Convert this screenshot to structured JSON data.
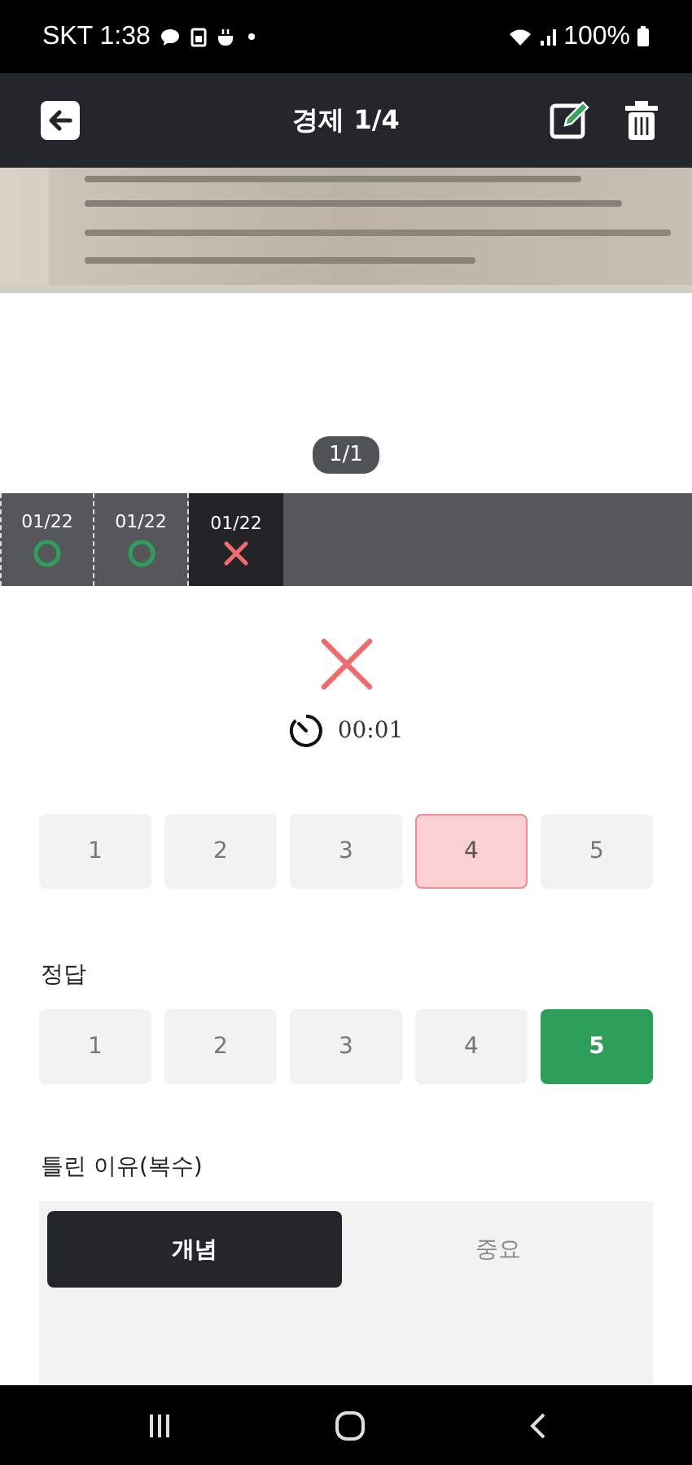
{
  "status_bar": {
    "carrier_time": "SKT 1:38",
    "battery": "100%"
  },
  "app_bar": {
    "title": "경제 1/4"
  },
  "page_indicator": "1/1",
  "history": [
    {
      "date": "01/22",
      "kind": "correct",
      "selected": false
    },
    {
      "date": "01/22",
      "kind": "correct",
      "selected": false
    },
    {
      "date": "01/22",
      "kind": "wrong",
      "selected": true
    }
  ],
  "result": {
    "kind": "wrong",
    "time": "00:01"
  },
  "my_answer": {
    "options": [
      {
        "label": "1",
        "selected": false
      },
      {
        "label": "2",
        "selected": false
      },
      {
        "label": "3",
        "selected": false
      },
      {
        "label": "4",
        "selected": true
      },
      {
        "label": "5",
        "selected": false
      }
    ]
  },
  "correct_answer": {
    "title": "정답",
    "options": [
      {
        "label": "1",
        "selected": false
      },
      {
        "label": "2",
        "selected": false
      },
      {
        "label": "3",
        "selected": false
      },
      {
        "label": "4",
        "selected": false
      },
      {
        "label": "5",
        "selected": true
      }
    ]
  },
  "reasons": {
    "title": "틀린 이유(복수)",
    "options": [
      {
        "label": "개념",
        "selected": true
      },
      {
        "label": "중요",
        "selected": false
      }
    ]
  }
}
